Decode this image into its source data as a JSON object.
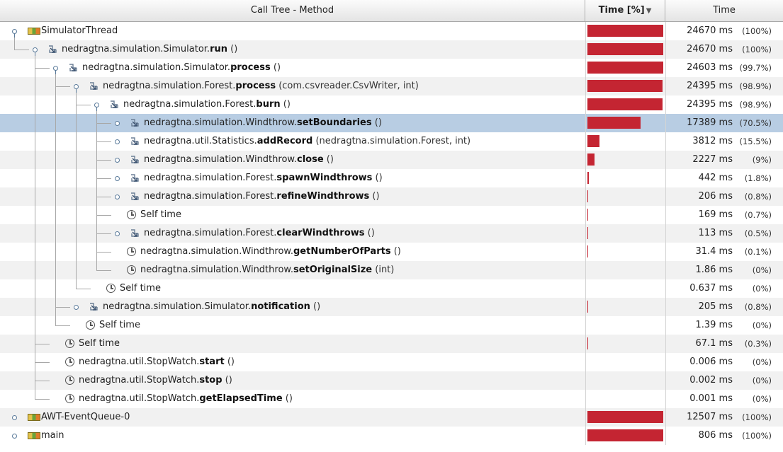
{
  "header": {
    "method": "Call Tree - Method",
    "time_pct": "Time [%]",
    "time": "Time",
    "sort_icon": "sort-descending-icon"
  },
  "bar_color": "#c42532",
  "selection_color": "#b8cde3",
  "rows": [
    {
      "level": 0,
      "kind": "thread",
      "toggle": "open",
      "prefix": "SimulatorThread",
      "method": "",
      "params": "",
      "ms": "24670 ms",
      "pct": "(100%)",
      "fraction": 1.0
    },
    {
      "level": 1,
      "kind": "method",
      "toggle": "open",
      "prefix": "nedragtna.simulation.Simulator.",
      "method": "run",
      "params": " ()",
      "ms": "24670 ms",
      "pct": "(100%)",
      "fraction": 1.0
    },
    {
      "level": 2,
      "kind": "method",
      "toggle": "open",
      "prefix": "nedragtna.simulation.Simulator.",
      "method": "process",
      "params": " ()",
      "ms": "24603 ms",
      "pct": "(99.7%)",
      "fraction": 0.997
    },
    {
      "level": 3,
      "kind": "method",
      "toggle": "open",
      "prefix": "nedragtna.simulation.Forest.",
      "method": "process",
      "params": " (com.csvreader.CsvWriter, int)",
      "ms": "24395 ms",
      "pct": "(98.9%)",
      "fraction": 0.989
    },
    {
      "level": 4,
      "kind": "method",
      "toggle": "open",
      "prefix": "nedragtna.simulation.Forest.",
      "method": "burn",
      "params": " ()",
      "ms": "24395 ms",
      "pct": "(98.9%)",
      "fraction": 0.989
    },
    {
      "level": 5,
      "kind": "method",
      "toggle": "closed",
      "prefix": "nedragtna.simulation.Windthrow.",
      "method": "setBoundaries",
      "params": " ()",
      "ms": "17389 ms",
      "pct": "(70.5%)",
      "fraction": 0.705,
      "selected": true
    },
    {
      "level": 5,
      "kind": "method",
      "toggle": "closed",
      "prefix": "nedragtna.util.Statistics.",
      "method": "addRecord",
      "params": " (nedragtna.simulation.Forest, int)",
      "ms": "3812 ms",
      "pct": "(15.5%)",
      "fraction": 0.155
    },
    {
      "level": 5,
      "kind": "method",
      "toggle": "closed",
      "prefix": "nedragtna.simulation.Windthrow.",
      "method": "close",
      "params": " ()",
      "ms": "2227 ms",
      "pct": "(9%)",
      "fraction": 0.09
    },
    {
      "level": 5,
      "kind": "method",
      "toggle": "closed",
      "prefix": "nedragtna.simulation.Forest.",
      "method": "spawnWindthrows",
      "params": " ()",
      "ms": "442 ms",
      "pct": "(1.8%)",
      "fraction": 0.018
    },
    {
      "level": 5,
      "kind": "method",
      "toggle": "closed",
      "prefix": "nedragtna.simulation.Forest.",
      "method": "refineWindthrows",
      "params": " ()",
      "ms": "206 ms",
      "pct": "(0.8%)",
      "fraction": 0.008
    },
    {
      "level": 5,
      "kind": "self",
      "toggle": "none",
      "prefix": "Self time",
      "method": "",
      "params": "",
      "ms": "169 ms",
      "pct": "(0.7%)",
      "fraction": 0.007
    },
    {
      "level": 5,
      "kind": "method",
      "toggle": "closed",
      "prefix": "nedragtna.simulation.Forest.",
      "method": "clearWindthrows",
      "params": " ()",
      "ms": "113 ms",
      "pct": "(0.5%)",
      "fraction": 0.005
    },
    {
      "level": 5,
      "kind": "self",
      "toggle": "none",
      "prefix": "nedragtna.simulation.Windthrow.",
      "method": "getNumberOfParts",
      "params": " ()",
      "ms": "31.4 ms",
      "pct": "(0.1%)",
      "fraction": 0.001
    },
    {
      "level": 5,
      "kind": "self",
      "toggle": "none",
      "prefix": "nedragtna.simulation.Windthrow.",
      "method": "setOriginalSize",
      "params": " (int)",
      "ms": "1.86 ms",
      "pct": "(0%)",
      "fraction": 0
    },
    {
      "level": 4,
      "kind": "self",
      "toggle": "none",
      "prefix": "Self time",
      "method": "",
      "params": "",
      "ms": "0.637 ms",
      "pct": "(0%)",
      "fraction": 0
    },
    {
      "level": 3,
      "kind": "method",
      "toggle": "closed",
      "prefix": "nedragtna.simulation.Simulator.",
      "method": "notification",
      "params": " ()",
      "ms": "205 ms",
      "pct": "(0.8%)",
      "fraction": 0.008
    },
    {
      "level": 3,
      "kind": "self",
      "toggle": "none",
      "prefix": "Self time",
      "method": "",
      "params": "",
      "ms": "1.39 ms",
      "pct": "(0%)",
      "fraction": 0
    },
    {
      "level": 2,
      "kind": "self",
      "toggle": "none",
      "prefix": "Self time",
      "method": "",
      "params": "",
      "ms": "67.1 ms",
      "pct": "(0.3%)",
      "fraction": 0.003
    },
    {
      "level": 2,
      "kind": "self",
      "toggle": "none",
      "prefix": "nedragtna.util.StopWatch.",
      "method": "start",
      "params": " ()",
      "ms": "0.006 ms",
      "pct": "(0%)",
      "fraction": 0
    },
    {
      "level": 2,
      "kind": "self",
      "toggle": "none",
      "prefix": "nedragtna.util.StopWatch.",
      "method": "stop",
      "params": " ()",
      "ms": "0.002 ms",
      "pct": "(0%)",
      "fraction": 0
    },
    {
      "level": 2,
      "kind": "self",
      "toggle": "none",
      "prefix": "nedragtna.util.StopWatch.",
      "method": "getElapsedTime",
      "params": " ()",
      "ms": "0.001 ms",
      "pct": "(0%)",
      "fraction": 0
    },
    {
      "level": 0,
      "kind": "thread",
      "toggle": "closed",
      "prefix": "AWT-EventQueue-0",
      "method": "",
      "params": "",
      "ms": "12507 ms",
      "pct": "(100%)",
      "fraction": 1.0
    },
    {
      "level": 0,
      "kind": "thread",
      "toggle": "closed",
      "prefix": "main",
      "method": "",
      "params": "",
      "ms": "806 ms",
      "pct": "(100%)",
      "fraction": 1.0
    }
  ]
}
